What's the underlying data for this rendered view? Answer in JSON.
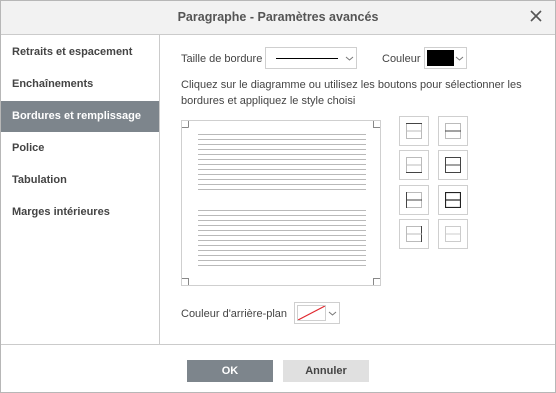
{
  "dialog": {
    "title": "Paragraphe - Paramètres avancés",
    "close_icon": "close-icon"
  },
  "sidebar": {
    "items": [
      {
        "label": "Retraits et espacement",
        "active": false
      },
      {
        "label": "Enchaînements",
        "active": false
      },
      {
        "label": "Bordures et remplissage",
        "active": true
      },
      {
        "label": "Police",
        "active": false
      },
      {
        "label": "Tabulation",
        "active": false
      },
      {
        "label": "Marges intérieures",
        "active": false
      }
    ]
  },
  "borders": {
    "size_label": "Taille de bordure",
    "color_label": "Couleur",
    "color_value": "#000000",
    "instructions": "Cliquez sur le diagramme ou utilisez les boutons pour sélectionner les bordures et appliquez le style choisi",
    "border_buttons": [
      {
        "icon": "border-top-icon"
      },
      {
        "icon": "border-inner-horizontal-icon"
      },
      {
        "icon": "border-bottom-icon"
      },
      {
        "icon": "border-top-bottom-icon"
      },
      {
        "icon": "border-left-icon"
      },
      {
        "icon": "border-all-icon"
      },
      {
        "icon": "border-right-icon"
      },
      {
        "icon": "border-none-icon"
      }
    ],
    "background_label": "Couleur d'arrière-plan",
    "background_value": "none"
  },
  "footer": {
    "ok_label": "OK",
    "cancel_label": "Annuler"
  },
  "colors": {
    "accent": "#7d858c",
    "titlebar": "#f2f2f2"
  }
}
